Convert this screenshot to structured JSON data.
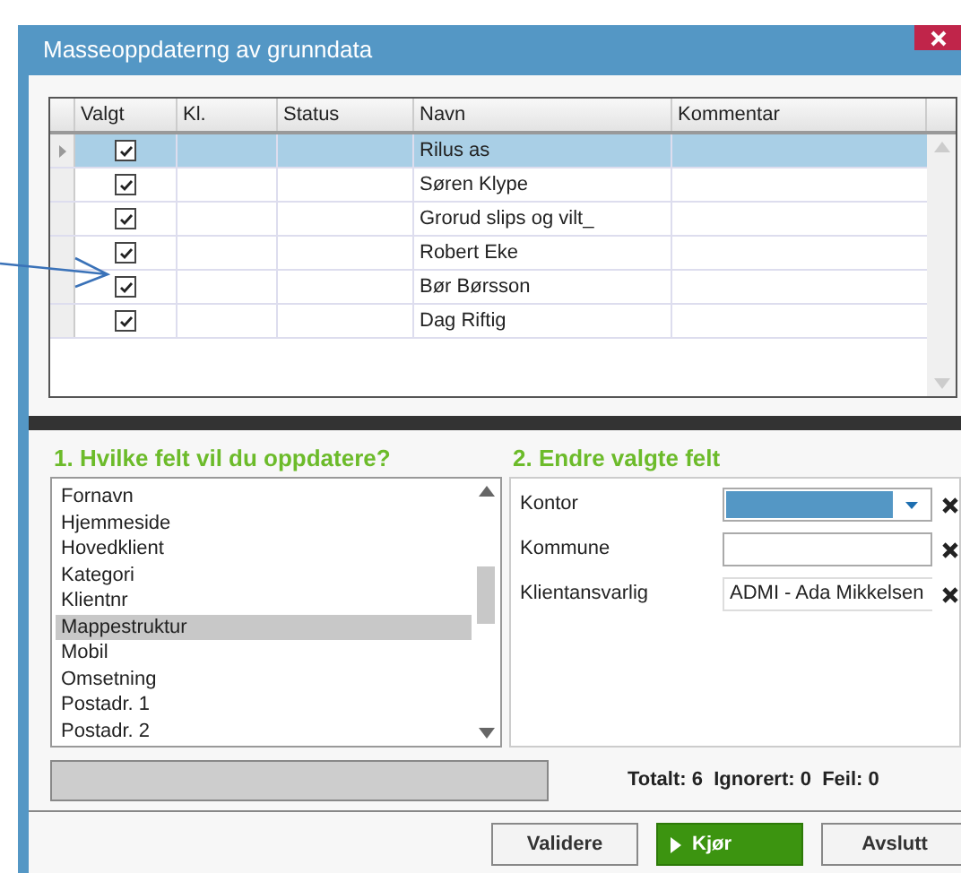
{
  "window": {
    "title": "Masseoppdaterng av grunndata"
  },
  "grid": {
    "columns": [
      "Valgt",
      "Kl.",
      "Status",
      "Navn",
      "Kommentar"
    ],
    "rows": [
      {
        "checked": true,
        "selected": true,
        "name": "Rilus as"
      },
      {
        "checked": true,
        "selected": false,
        "name": "Søren Klype"
      },
      {
        "checked": true,
        "selected": false,
        "name": "Grorud slips og vilt_"
      },
      {
        "checked": true,
        "selected": false,
        "name": "Robert Eke"
      },
      {
        "checked": true,
        "selected": false,
        "name": "Bør Børsson"
      },
      {
        "checked": true,
        "selected": false,
        "name": "Dag Riftig"
      }
    ]
  },
  "section_1": {
    "heading": "1. Hvilke felt vil du oppdatere?",
    "items": [
      {
        "label": "Fornavn",
        "selected": false
      },
      {
        "label": "Hjemmeside",
        "selected": false
      },
      {
        "label": "Hovedklient",
        "selected": false
      },
      {
        "label": "Kategori",
        "selected": false
      },
      {
        "label": "Klientnr",
        "selected": false
      },
      {
        "label": "Mappestruktur",
        "selected": true
      },
      {
        "label": "Mobil",
        "selected": false
      },
      {
        "label": "Omsetning",
        "selected": false
      },
      {
        "label": "Postadr. 1",
        "selected": false
      },
      {
        "label": "Postadr. 2",
        "selected": false
      }
    ]
  },
  "section_2": {
    "heading": "2. Endre valgte felt",
    "fields": [
      {
        "kind": "dropdown",
        "label": "Kontor"
      },
      {
        "kind": "text",
        "label": "Kommune"
      },
      {
        "kind": "text",
        "label": "Klientansvarlig",
        "value": "ADMI - Ada Mikkelsen"
      }
    ]
  },
  "status": {
    "summary": "Totalt: 6  Ignorert: 0  Feil: 0"
  },
  "buttons": [
    {
      "kind": "default",
      "label": "Validere"
    },
    {
      "kind": "primary",
      "label": "Kjør"
    },
    {
      "kind": "default",
      "label": "Avslutt"
    }
  ]
}
